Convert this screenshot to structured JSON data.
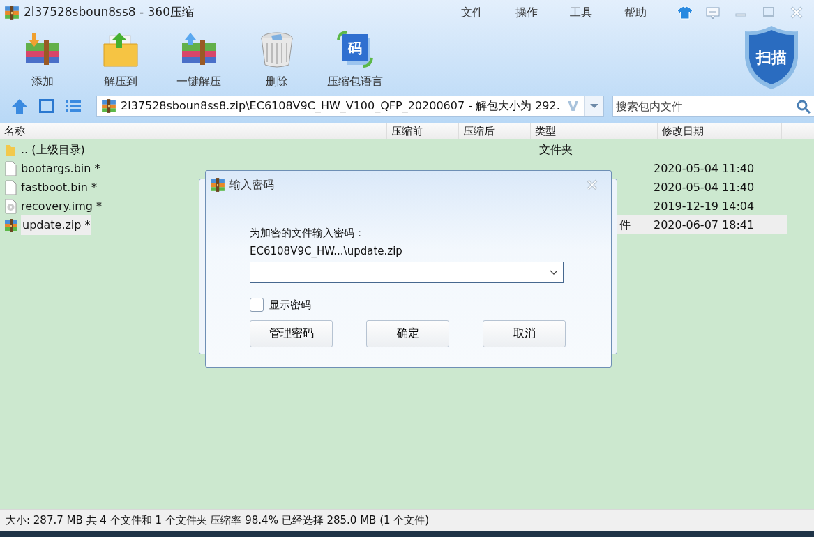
{
  "window": {
    "title": "2l37528sboun8ss8 - 360压缩"
  },
  "menu": [
    {
      "label": "文件"
    },
    {
      "label": "操作"
    },
    {
      "label": "工具"
    },
    {
      "label": "帮助"
    }
  ],
  "toolbar": [
    {
      "label": "添加",
      "kind": "add"
    },
    {
      "label": "解压到",
      "kind": "extract"
    },
    {
      "label": "一键解压",
      "kind": "quick"
    },
    {
      "label": "删除",
      "kind": "delete"
    },
    {
      "label": "压缩包语言",
      "kind": "language",
      "icon_text": "码"
    }
  ],
  "scan_button": {
    "label": "扫描"
  },
  "address": {
    "path": "2l37528sboun8ss8.zip\\EC6108V9C_HW_V100_QFP_20200607 - 解包大小为 292.",
    "badge": "V"
  },
  "search": {
    "placeholder": "搜索包内文件"
  },
  "columns": [
    "名称",
    "压缩前",
    "压缩后",
    "类型",
    "修改日期"
  ],
  "rows": [
    {
      "kind": "folder",
      "name": ".. (上级目录)",
      "type": "文件夹",
      "selected": false
    },
    {
      "kind": "file",
      "name": "bootargs.bin *",
      "date": "2020-05-04 11:40",
      "selected": false
    },
    {
      "kind": "file",
      "name": "fastboot.bin *",
      "date": "2020-05-04 11:40",
      "selected": false
    },
    {
      "kind": "disc",
      "name": "recovery.img *",
      "date": "2019-12-19 14:04",
      "selected": false
    },
    {
      "kind": "archive",
      "name": "update.zip *",
      "type": "件",
      "type_partial": true,
      "date": "2020-06-07 18:41",
      "selected": true
    }
  ],
  "status_bar": "大小: 287.7 MB 共 4 个文件和 1 个文件夹 压缩率 98.4% 已经选择 285.0 MB (1 个文件)",
  "dialog": {
    "title": "输入密码",
    "prompt": "为加密的文件输入密码：",
    "file": "EC6108V9C_HW...\\update.zip",
    "show_password": {
      "label": "显示密码",
      "checked": false
    },
    "buttons": [
      "管理密码",
      "确定",
      "取消"
    ]
  }
}
